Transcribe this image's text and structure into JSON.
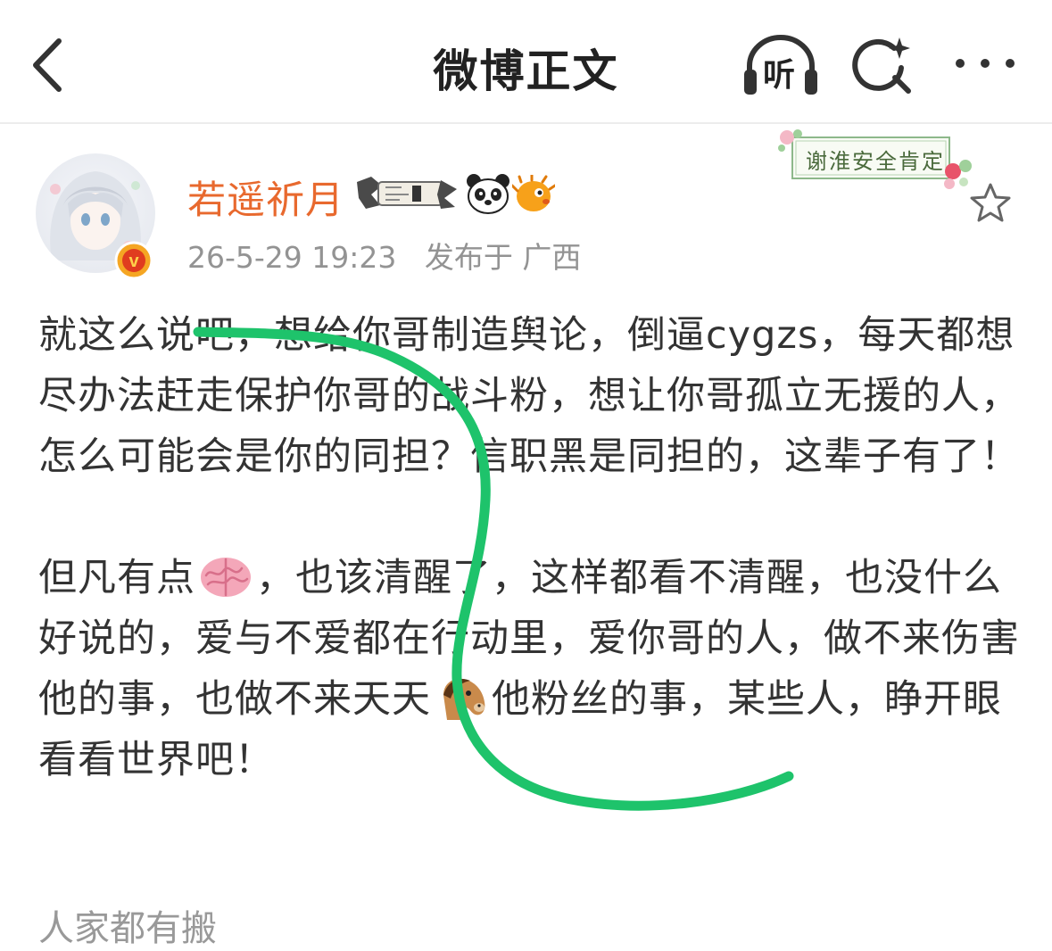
{
  "nav": {
    "title": "微博正文",
    "listen_label": "听"
  },
  "post": {
    "author": {
      "name": "若遥祈月",
      "verified_badge": "v"
    },
    "timestamp": "26-5-29 19:23",
    "location": "发布于 广西",
    "decoration_text": "谢淮安全肯定",
    "paragraphs": [
      {
        "before": "就这么说吧，想给你哥制造舆论，倒逼cygzs，每天都想尽办法赶走保护你哥的战斗粉，想让你哥孤立无援的人，怎么可能会是你的同担？信职黑是同担的，这辈子有了！"
      },
      {
        "before": "但凡有点",
        "emoji1": "brain-emoji",
        "middle": "，也该清醒了，这样都看不清醒，也没什么好说的，爱与不爱都在行动里，爱你哥的人，做不来伤害他的事，也做不来天天",
        "emoji2": "horse-emoji",
        "after": "他粉丝的事，某些人，睁开眼看看世界吧！"
      }
    ],
    "truncated_next_line": "人家都有搬"
  },
  "icons": {
    "back": "chevron-left-icon",
    "listen": "headphones-icon",
    "search": "search-sparkle-icon",
    "more": "more-dots-icon",
    "favorite": "star-outline-icon"
  },
  "colors": {
    "username": "#e8692e",
    "meta": "#939393",
    "body_text": "#333333",
    "annotation_stroke": "#1ec36b",
    "verified_badge": "#f5a623"
  }
}
